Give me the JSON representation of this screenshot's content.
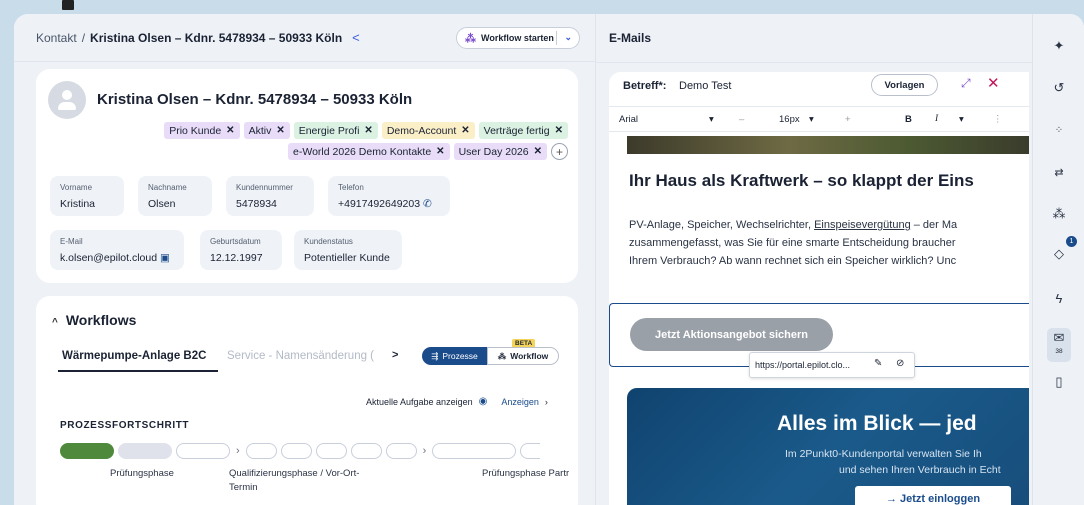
{
  "breadcrumb": {
    "root": "Kontakt",
    "sep": "/",
    "current": "Kristina Olsen – Kdnr. 5478934 – 50933 Köln"
  },
  "workflow_start": {
    "label": "Workflow starten"
  },
  "contact": {
    "name": "Kristina Olsen – Kdnr. 5478934 – 50933 Köln",
    "tags": [
      {
        "label": "Prio Kunde",
        "color": "#e8dcf8"
      },
      {
        "label": "Aktiv",
        "color": "#e8dcf8"
      },
      {
        "label": "Energie Profi",
        "color": "#dbf1e2"
      },
      {
        "label": "Demo-Account",
        "color": "#fbefc8"
      },
      {
        "label": "Verträge fertig",
        "color": "#dbf1e2"
      },
      {
        "label": "e-World 2026 Demo Kontakte",
        "color": "#e8dcf8"
      },
      {
        "label": "User Day 2026",
        "color": "#e8dcf8"
      }
    ],
    "fields": {
      "vorname": {
        "label": "Vorname",
        "value": "Kristina"
      },
      "nachname": {
        "label": "Nachname",
        "value": "Olsen"
      },
      "kundennummer": {
        "label": "Kundennummer",
        "value": "5478934"
      },
      "telefon": {
        "label": "Telefon",
        "value": "+4917492649203"
      },
      "email": {
        "label": "E-Mail",
        "value": "k.olsen@epilot.cloud"
      },
      "geburtsdatum": {
        "label": "Geburtsdatum",
        "value": "12.12.1997"
      },
      "kundenstatus": {
        "label": "Kundenstatus",
        "value": "Potentieller Kunde"
      }
    }
  },
  "workflows": {
    "title": "Workflows",
    "tab_active": "Wärmepumpe-Anlage B2C",
    "tab_muted": "Service - Namensänderung (",
    "btn_prozesse": "Prozesse",
    "btn_workflow": "Workflow",
    "beta": "BETA",
    "task_link": "Aktuelle Aufgabe anzeigen",
    "anzeigen": "Anzeigen",
    "progress_title": "PROZESSFORTSCHRITT",
    "phases": [
      "Prüfungsphase",
      "Qualifizierungsphase / Vor-Ort-",
      "Termin",
      "Prüfungsphase Partr"
    ]
  },
  "email": {
    "panel_title": "E-Mails",
    "subject_label": "Betreff*:",
    "subject_value": "Demo Test",
    "vorlagen": "Vorlagen",
    "toolbar": {
      "font": "Arial",
      "size": "16px",
      "minus": "–",
      "plus": "+",
      "bold": "B",
      "italic": "I"
    },
    "headline": "Ihr Haus als Kraftwerk – so klappt der Eins",
    "body_line1_pre": "PV-Anlage, Speicher, Wechselrichter, ",
    "body_line1_link": "Einspeisevergütung",
    "body_line1_post": " – der Ma",
    "body_line2": "zusammengefasst, was Sie für eine smarte Entscheidung braucher",
    "body_line3": "Ihrem Verbrauch? Ab wann rechnet sich ein Speicher wirklich? Unc",
    "cta": "Jetzt Aktionsangebot sichern",
    "link_url": "https://portal.epilot.clo...",
    "promo_title": "Alles im Blick — jed",
    "promo_sub1": "Im 2Punkt0-Kundenportal verwalten Sie Ih",
    "promo_sub2": "und sehen Ihren Verbrauch in Echt",
    "login": "→ Jetzt einloggen"
  },
  "rail": {
    "badge_count": "1",
    "mail_count": "38",
    "icons": [
      "sparkle-icon",
      "history-icon",
      "apps-icon",
      "flow-icon",
      "workflow-icon",
      "tasks-icon",
      "automation-icon",
      "mail-icon",
      "file-icon"
    ]
  }
}
